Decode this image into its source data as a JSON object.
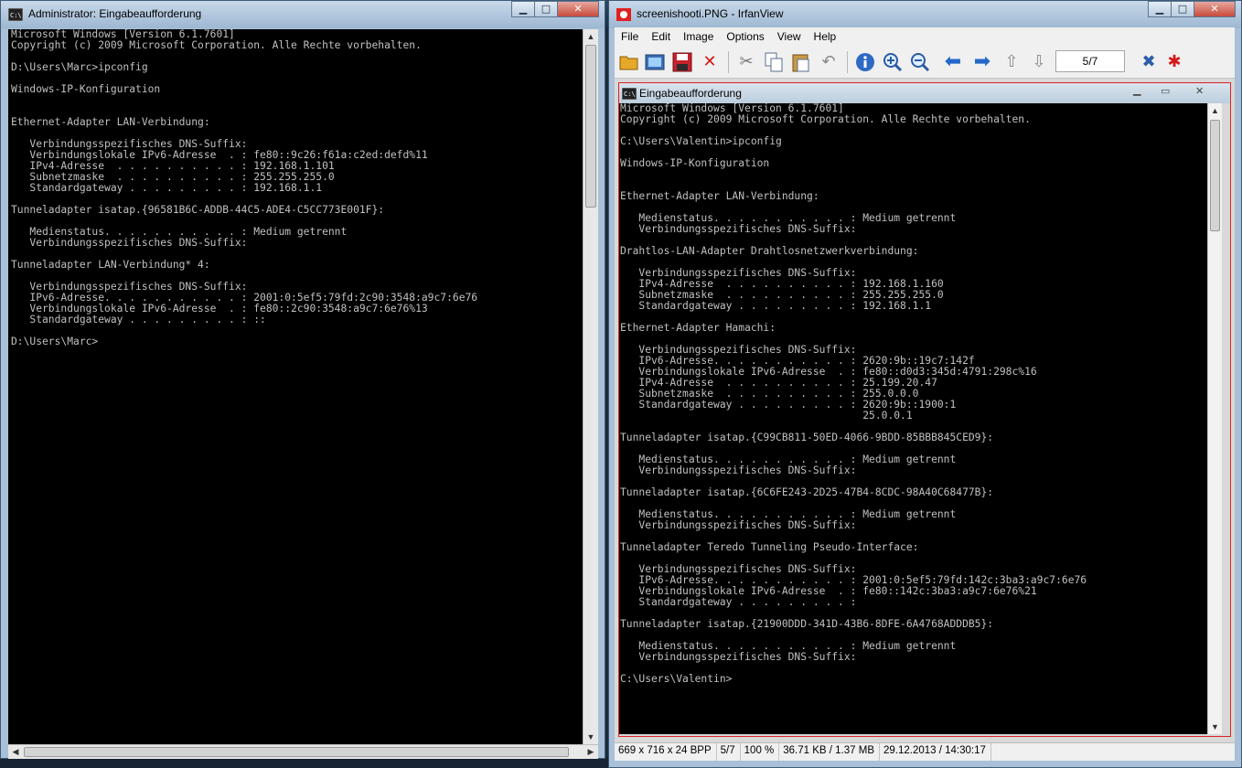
{
  "left_window": {
    "title": "Administrator: Eingabeaufforderung",
    "lines": [
      "Microsoft Windows [Version 6.1.7601]",
      "Copyright (c) 2009 Microsoft Corporation. Alle Rechte vorbehalten.",
      "",
      "D:\\Users\\Marc>ipconfig",
      "",
      "Windows-IP-Konfiguration",
      "",
      "",
      "Ethernet-Adapter LAN-Verbindung:",
      "",
      "   Verbindungsspezifisches DNS-Suffix:",
      "   Verbindungslokale IPv6-Adresse  . : fe80::9c26:f61a:c2ed:defd%11",
      "   IPv4-Adresse  . . . . . . . . . . : 192.168.1.101",
      "   Subnetzmaske  . . . . . . . . . . : 255.255.255.0",
      "   Standardgateway . . . . . . . . . : 192.168.1.1",
      "",
      "Tunneladapter isatap.{96581B6C-ADDB-44C5-ADE4-C5CC773E001F}:",
      "",
      "   Medienstatus. . . . . . . . . . . : Medium getrennt",
      "   Verbindungsspezifisches DNS-Suffix:",
      "",
      "Tunneladapter LAN-Verbindung* 4:",
      "",
      "   Verbindungsspezifisches DNS-Suffix:",
      "   IPv6-Adresse. . . . . . . . . . . : 2001:0:5ef5:79fd:2c90:3548:a9c7:6e76",
      "   Verbindungslokale IPv6-Adresse  . : fe80::2c90:3548:a9c7:6e76%13",
      "   Standardgateway . . . . . . . . . : ::",
      "",
      "D:\\Users\\Marc>"
    ]
  },
  "irfanview": {
    "title": "screenishooti.PNG - IrfanView",
    "menu": [
      "File",
      "Edit",
      "Image",
      "Options",
      "View",
      "Help"
    ],
    "toolbar_icons": [
      "open-folder-icon",
      "slideshow-icon",
      "save-icon",
      "delete-icon",
      "cut-icon",
      "copy-icon",
      "paste-icon",
      "undo-icon",
      "info-icon",
      "zoom-in-icon",
      "zoom-out-icon",
      "previous-icon",
      "next-icon",
      "first-page-icon",
      "last-page-icon",
      "settings-icon",
      "irfanview-logo-icon"
    ],
    "page_indicator": "5/7",
    "status": {
      "dimensions": "669 x 716 x 24 BPP",
      "page": "5/7",
      "zoom": "100 %",
      "size": "36.71 KB / 1.37 MB",
      "datetime": "29.12.2013 / 14:30:17"
    }
  },
  "inner_window": {
    "title": "Eingabeaufforderung",
    "lines": [
      "Microsoft Windows [Version 6.1.7601]",
      "Copyright (c) 2009 Microsoft Corporation. Alle Rechte vorbehalten.",
      "",
      "C:\\Users\\Valentin>ipconfig",
      "",
      "Windows-IP-Konfiguration",
      "",
      "",
      "Ethernet-Adapter LAN-Verbindung:",
      "",
      "   Medienstatus. . . . . . . . . . . : Medium getrennt",
      "   Verbindungsspezifisches DNS-Suffix:",
      "",
      "Drahtlos-LAN-Adapter Drahtlosnetzwerkverbindung:",
      "",
      "   Verbindungsspezifisches DNS-Suffix:",
      "   IPv4-Adresse  . . . . . . . . . . : 192.168.1.160",
      "   Subnetzmaske  . . . . . . . . . . : 255.255.255.0",
      "   Standardgateway . . . . . . . . . : 192.168.1.1",
      "",
      "Ethernet-Adapter Hamachi:",
      "",
      "   Verbindungsspezifisches DNS-Suffix:",
      "   IPv6-Adresse. . . . . . . . . . . : 2620:9b::19c7:142f",
      "   Verbindungslokale IPv6-Adresse  . : fe80::d0d3:345d:4791:298c%16",
      "   IPv4-Adresse  . . . . . . . . . . : 25.199.20.47",
      "   Subnetzmaske  . . . . . . . . . . : 255.0.0.0",
      "   Standardgateway . . . . . . . . . : 2620:9b::1900:1",
      "                                       25.0.0.1",
      "",
      "Tunneladapter isatap.{C99CB811-50ED-4066-9BDD-85BBB845CED9}:",
      "",
      "   Medienstatus. . . . . . . . . . . : Medium getrennt",
      "   Verbindungsspezifisches DNS-Suffix:",
      "",
      "Tunneladapter isatap.{6C6FE243-2D25-47B4-8CDC-98A40C68477B}:",
      "",
      "   Medienstatus. . . . . . . . . . . : Medium getrennt",
      "   Verbindungsspezifisches DNS-Suffix:",
      "",
      "Tunneladapter Teredo Tunneling Pseudo-Interface:",
      "",
      "   Verbindungsspezifisches DNS-Suffix:",
      "   IPv6-Adresse. . . . . . . . . . . : 2001:0:5ef5:79fd:142c:3ba3:a9c7:6e76",
      "   Verbindungslokale IPv6-Adresse  . : fe80::142c:3ba3:a9c7:6e76%21",
      "   Standardgateway . . . . . . . . . :",
      "",
      "Tunneladapter isatap.{21900DDD-341D-43B6-8DFE-6A4768ADDDB5}:",
      "",
      "   Medienstatus. . . . . . . . . . . : Medium getrennt",
      "   Verbindungsspezifisches DNS-Suffix:",
      "",
      "C:\\Users\\Valentin>"
    ]
  },
  "colors": {
    "console_bg": "#000000",
    "console_fg": "#c0c0c0",
    "frame_red": "#dd2222",
    "close_red": "#c74b3c"
  }
}
